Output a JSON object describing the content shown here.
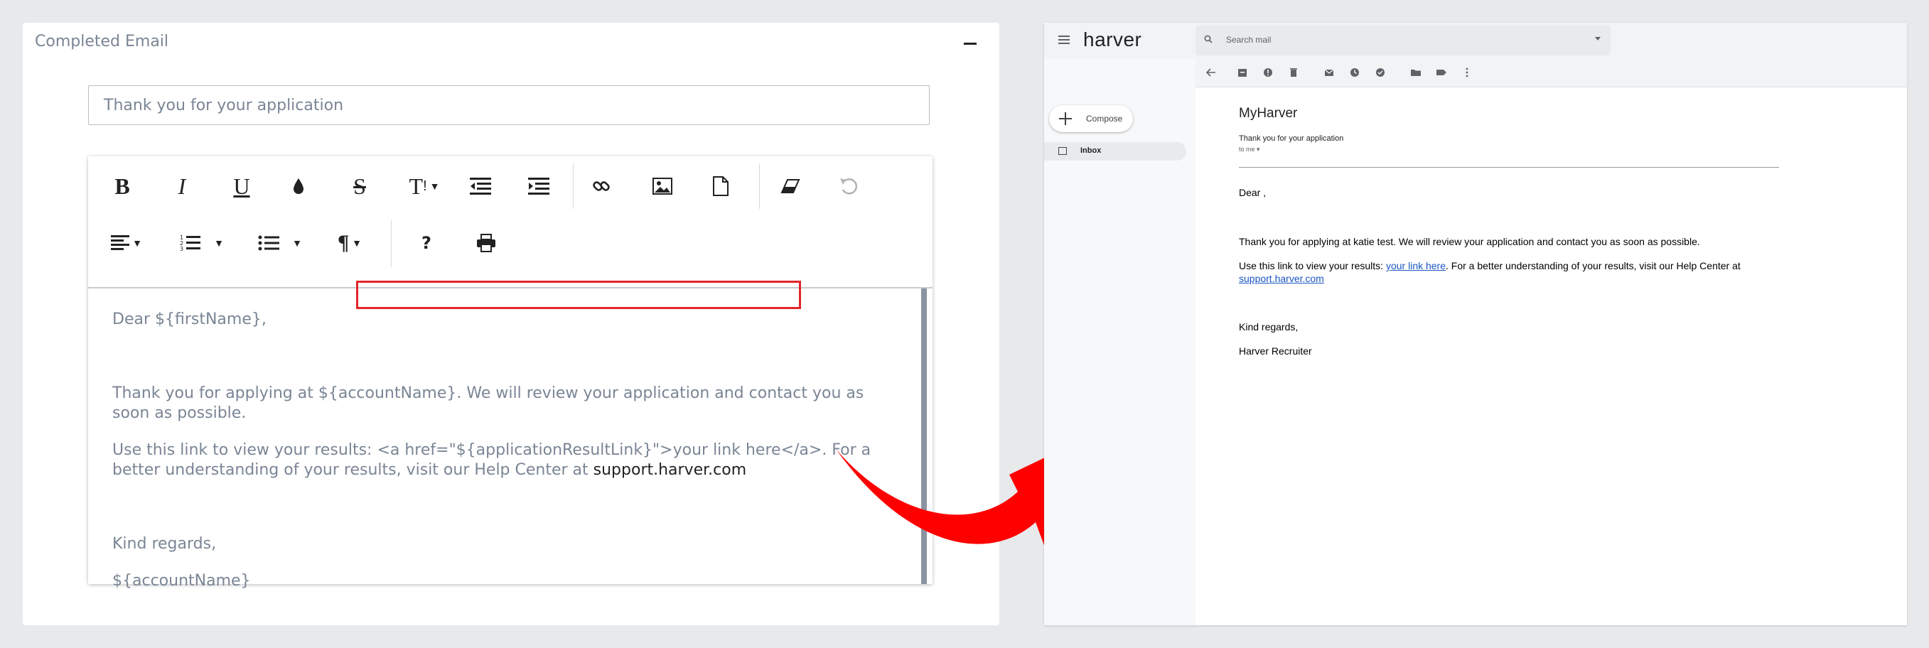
{
  "editor": {
    "panel_title": "Completed Email",
    "subject_value": "Thank you for your application",
    "body": {
      "greeting": "Dear ${firstName},",
      "para1": "Thank you for applying at ${accountName}. We will review your application and contact you as soon as possible.",
      "para2_prefix": "Use this link to view your results: ",
      "para2_link_code": "<a href=\"${applicationResultLink}\">your link here</a>",
      "para2_suffix": ". For a better understanding of your results, visit our Help Center at ",
      "para2_support": "support.harver.com",
      "closing": "Kind regards,",
      "signature": "${accountName}"
    },
    "toolbar_icons": [
      "bold-icon",
      "italic-icon",
      "underline-icon",
      "text-color-icon",
      "strikethrough-icon",
      "font-size-icon",
      "outdent-icon",
      "indent-icon",
      "link-icon",
      "image-icon",
      "file-icon",
      "clear-format-icon",
      "undo-icon",
      "align-icon",
      "ordered-list-icon",
      "unordered-list-icon",
      "paragraph-icon",
      "help-icon",
      "print-icon"
    ]
  },
  "gmail": {
    "brand": "harver",
    "search_placeholder": "Search mail",
    "compose_label": "Compose",
    "inbox_label": "Inbox",
    "sender": "MyHarver",
    "subject": "Thank you for your application",
    "to_label": "to me",
    "greeting": "Dear ,",
    "para1": "Thank you for applying at katie test. We will review your application and contact you as soon as possible.",
    "para2_prefix": "Use this link to view your results: ",
    "para2_link": "your link here",
    "para2_suffix": ". For a better understanding of your results, visit our Help Center at ",
    "para2_support": "support.harver.com",
    "closing": "Kind regards,",
    "signature": "Harver Recruiter"
  },
  "colors": {
    "accent_red": "#e3252a",
    "link_blue": "#1a56c4"
  }
}
